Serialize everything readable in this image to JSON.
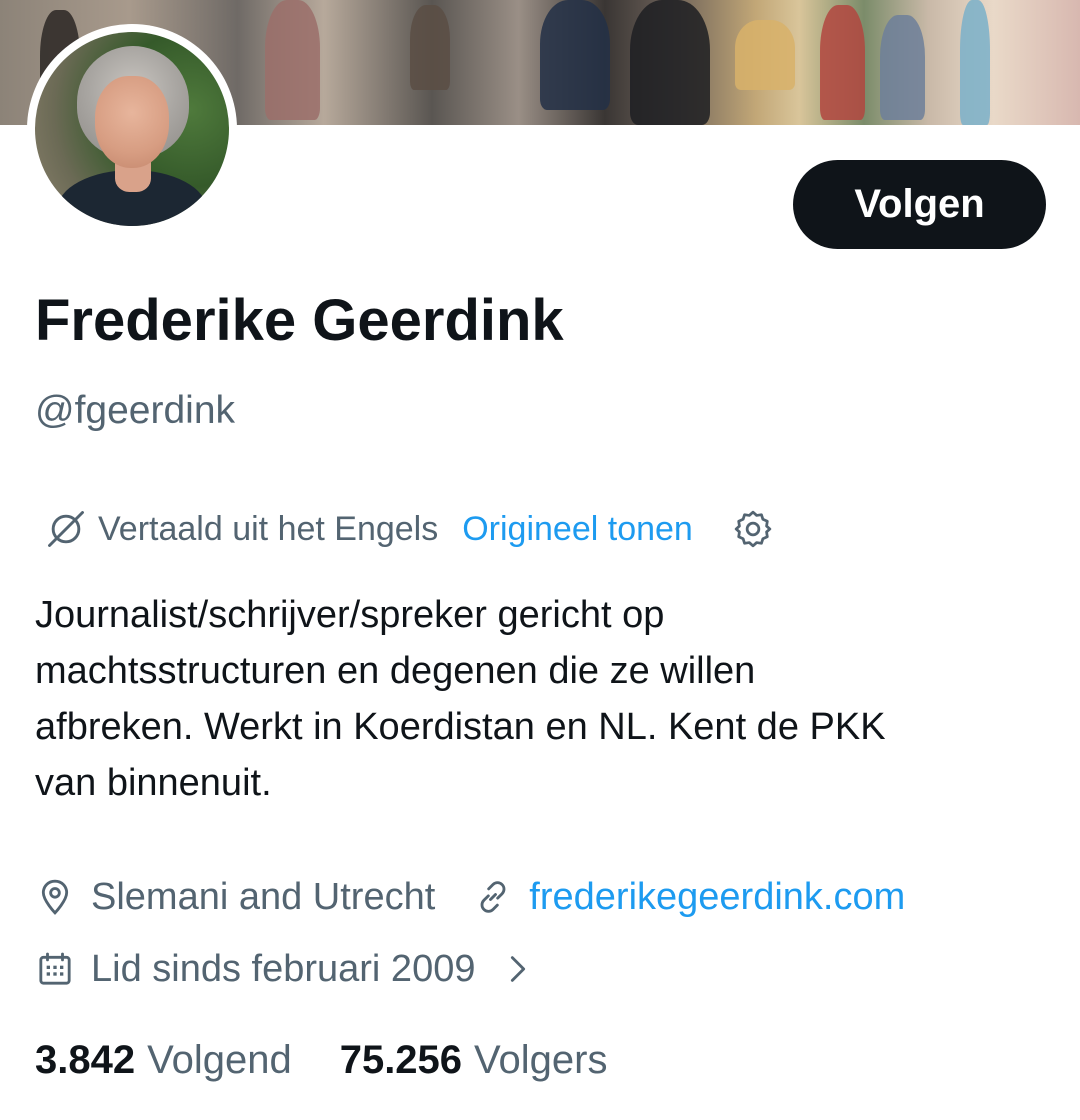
{
  "profile": {
    "name": "Frederike Geerdink",
    "handle": "@fgeerdink",
    "follow_label": "Volgen",
    "bio_lines": [
      "Journalist/schrijver/spreker gericht op",
      "machtsstructuren en degenen die ze willen",
      "afbreken. Werkt in Koerdistan en NL. Kent de PKK",
      "van binnenuit."
    ],
    "location": "Slemani and Utrecht",
    "website": "frederikegeerdink.com",
    "joined": "Lid sinds februari 2009"
  },
  "translation": {
    "label": "Vertaald uit het Engels",
    "show_original": "Origineel tonen"
  },
  "stats": {
    "following_count": "3.842",
    "following_label": "Volgend",
    "followers_count": "75.256",
    "followers_label": "Volgers"
  },
  "icons": {
    "translate": "translate-icon",
    "settings": "gear-icon",
    "location": "location-pin-icon",
    "link": "link-icon",
    "calendar": "calendar-icon",
    "chevron": "chevron-right-icon"
  },
  "colors": {
    "text_primary": "#0f1419",
    "text_secondary": "#536471",
    "link": "#1d9bf0",
    "button_bg": "#0f1419",
    "button_text": "#ffffff"
  }
}
